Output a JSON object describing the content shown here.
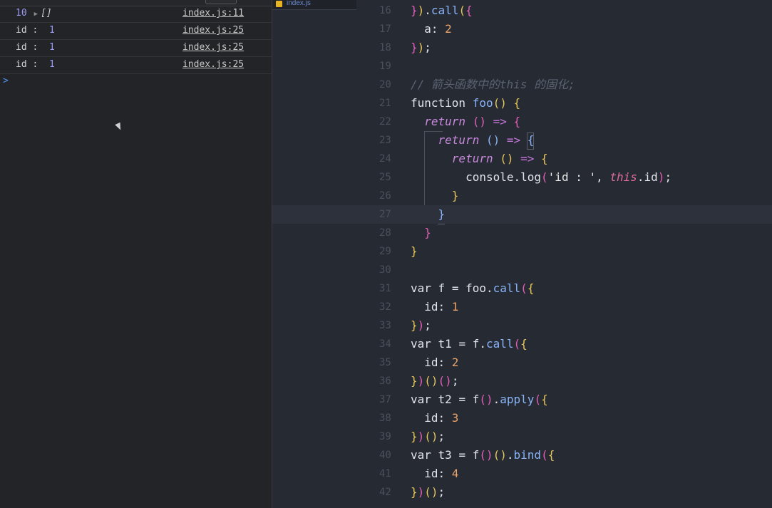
{
  "console": {
    "rows": [
      {
        "count": "10",
        "value": "[]",
        "source": "index.js:11"
      },
      {
        "label": "id :",
        "value": "1",
        "source": "index.js:25"
      },
      {
        "label": "id :",
        "value": "1",
        "source": "index.js:25"
      },
      {
        "label": "id :",
        "value": "1",
        "source": "index.js:25"
      }
    ],
    "prompt": ">"
  },
  "editor": {
    "tab_label": "index.js",
    "line_numbers": [
      "16",
      "17",
      "18",
      "19",
      "20",
      "21",
      "22",
      "23",
      "24",
      "25",
      "26",
      "27",
      "28",
      "29",
      "30",
      "31",
      "32",
      "33",
      "34",
      "35",
      "36",
      "37",
      "38",
      "39",
      "40",
      "41",
      "42"
    ],
    "comment": "// 箭头函数中的this 的固化;",
    "tokens": {
      "call": "call",
      "apply": "apply",
      "bind": "bind",
      "function": "function",
      "foo": "foo",
      "return": "return",
      "console_log": "console.log",
      "string": "'id : '",
      "this": "this",
      "var": "var",
      "f": "f",
      "t1": "t1",
      "t2": "t2",
      "t3": "t3",
      "a": "a",
      "id": "id"
    },
    "numbers": {
      "a": "2",
      "id1": "1",
      "id2": "2",
      "id3": "3",
      "id4": "4"
    }
  },
  "colors": {
    "console_bg": "#232427",
    "editor_bg": "#262a33",
    "number": "#9c9cf5",
    "link": "#4e8ff0"
  }
}
